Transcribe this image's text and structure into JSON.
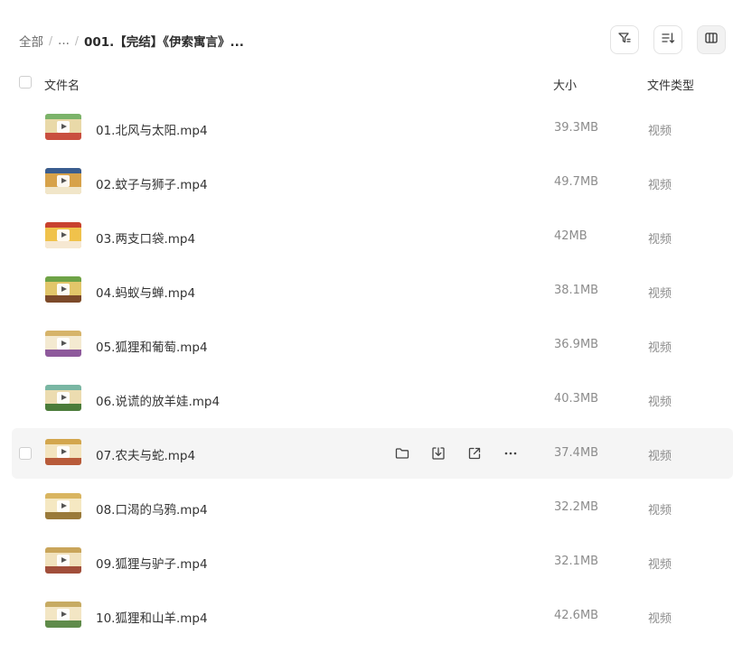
{
  "breadcrumb": {
    "root": "全部",
    "ellipsis": "...",
    "current": "001.【完结】《伊索寓言》..."
  },
  "toolbar": {
    "filter_icon": "filter-icon",
    "sort_icon": "sort-icon",
    "view_icon": "columns-view-icon"
  },
  "columns": {
    "name": "文件名",
    "size": "大小",
    "type": "文件类型"
  },
  "files": [
    {
      "name": "01.北风与太阳.mp4",
      "size": "39.3MB",
      "type": "视频",
      "thumb": [
        "#7bb36a",
        "#e9d9a8",
        "#c94f3f"
      ]
    },
    {
      "name": "02.蚊子与狮子.mp4",
      "size": "49.7MB",
      "type": "视频",
      "thumb": [
        "#3a5d8f",
        "#d7a24a",
        "#f1e6c9"
      ]
    },
    {
      "name": "03.两支口袋.mp4",
      "size": "42MB",
      "type": "视频",
      "thumb": [
        "#c8412f",
        "#f0c24b",
        "#f6e8d2"
      ]
    },
    {
      "name": "04.蚂蚁与蝉.mp4",
      "size": "38.1MB",
      "type": "视频",
      "thumb": [
        "#6ea347",
        "#e2c66a",
        "#7c4a2a"
      ]
    },
    {
      "name": "05.狐狸和葡萄.mp4",
      "size": "36.9MB",
      "type": "视频",
      "thumb": [
        "#d6b46a",
        "#f4ead1",
        "#8e5a9c"
      ]
    },
    {
      "name": "06.说谎的放羊娃.mp4",
      "size": "40.3MB",
      "type": "视频",
      "thumb": [
        "#79b6a3",
        "#ecdcb0",
        "#4b7c3a"
      ]
    },
    {
      "name": "07.农夫与蛇.mp4",
      "size": "37.4MB",
      "type": "视频",
      "thumb": [
        "#d3a64d",
        "#f3e4be",
        "#b85b3a"
      ]
    },
    {
      "name": "08.口渴的乌鸦.mp4",
      "size": "32.2MB",
      "type": "视频",
      "thumb": [
        "#d9b560",
        "#f5e8c2",
        "#9a7a3a"
      ]
    },
    {
      "name": "09.狐狸与驴子.mp4",
      "size": "32.1MB",
      "type": "视频",
      "thumb": [
        "#c9a55a",
        "#f1e2bd",
        "#a14e3a"
      ]
    },
    {
      "name": "10.狐狸和山羊.mp4",
      "size": "42.6MB",
      "type": "视频",
      "thumb": [
        "#c7ab63",
        "#f3e6c4",
        "#5f8b4a"
      ]
    }
  ],
  "hovered_row_actions": {
    "folder": "folder-icon",
    "download": "download-icon",
    "share": "share-icon",
    "more": "more-icon"
  }
}
